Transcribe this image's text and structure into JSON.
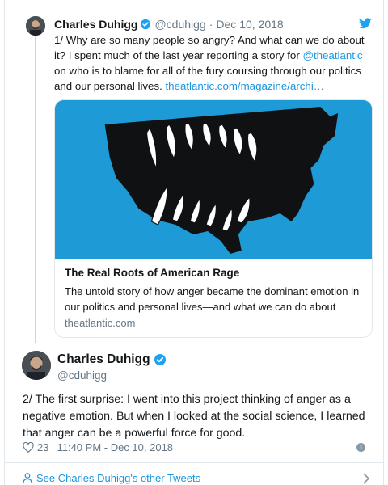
{
  "tweet1": {
    "name": "Charles Duhigg",
    "handle": "@cduhigg",
    "separator": "·",
    "date": "Dec 10, 2018",
    "text_part1": "1/ Why are so many people so angry? And what can we do about it? I spent much of the last year reporting a story for ",
    "mention": "@theatlantic",
    "text_part2": " on who is to blame for all of the fury coursing through our politics and our personal lives. ",
    "url": "theatlantic.com/magazine/archi…"
  },
  "link_card": {
    "title": "The Real Roots of American Rage",
    "description": "The untold story of how anger became the dominant emotion in our politics and personal lives—and what we can do about",
    "domain": "theatlantic.com"
  },
  "tweet2": {
    "name": "Charles Duhigg",
    "handle": "@cduhigg",
    "text": "2/ The first surprise: I went into this project thinking of anger as a negative emotion. But when I looked at the social science, I learned that anger can be a powerful force for good.",
    "likes": "23",
    "timestamp": "11:40 PM - Dec 10, 2018"
  },
  "footer": {
    "label": "See Charles Duhigg's other Tweets"
  },
  "icons": {
    "verified": "verified-badge-icon",
    "twitter": "twitter-bird-icon",
    "like": "heart-icon",
    "info": "info-icon",
    "person": "person-icon",
    "chevron": "chevron-right-icon"
  },
  "colors": {
    "accent": "#1b95e0",
    "card_image_bg": "#1e9bd7",
    "muted": "#657786",
    "border": "#e1e8ed"
  }
}
